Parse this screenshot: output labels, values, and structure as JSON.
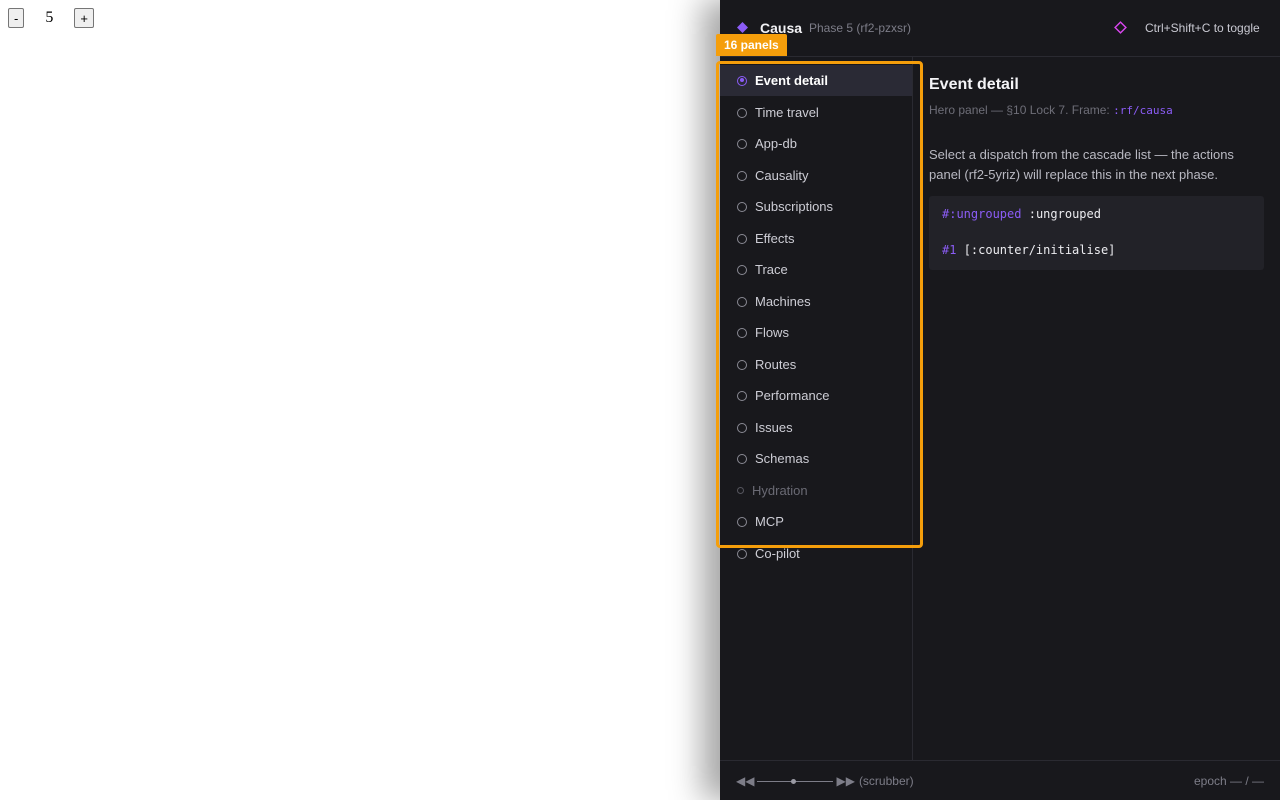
{
  "counter": {
    "decrement": "-",
    "value": "5",
    "increment": "+"
  },
  "devtools": {
    "brand": "Causa",
    "phase": "Phase 5 (rf2-pzxsr)",
    "toggle_hint": "Ctrl+Shift+C to toggle",
    "accent": "#8b5cf6",
    "overlay_badge": "16 panels",
    "overlay_color": "#f59e0b",
    "nav": [
      {
        "label": "Event detail",
        "state": "active"
      },
      {
        "label": "Time travel",
        "state": "normal"
      },
      {
        "label": "App-db",
        "state": "normal"
      },
      {
        "label": "Causality",
        "state": "normal"
      },
      {
        "label": "Subscriptions",
        "state": "normal"
      },
      {
        "label": "Effects",
        "state": "normal"
      },
      {
        "label": "Trace",
        "state": "normal"
      },
      {
        "label": "Machines",
        "state": "normal"
      },
      {
        "label": "Flows",
        "state": "normal"
      },
      {
        "label": "Routes",
        "state": "normal"
      },
      {
        "label": "Performance",
        "state": "normal"
      },
      {
        "label": "Issues",
        "state": "normal"
      },
      {
        "label": "Schemas",
        "state": "normal"
      },
      {
        "label": "Hydration",
        "state": "disabled"
      },
      {
        "label": "MCP",
        "state": "normal"
      },
      {
        "label": "Co-pilot",
        "state": "normal"
      }
    ],
    "main": {
      "title": "Event detail",
      "subtitle_prefix": "Hero panel — §10 Lock 7. Frame: ",
      "subtitle_frame": ":rf/causa",
      "description": "Select a dispatch from the cascade list — the actions panel (rf2-5yriz) will replace this in the next phase.",
      "code": {
        "line1_tag": "#:ungrouped",
        "line1_value": ":ungrouped",
        "line2_tag": "#1",
        "line2_value": "[:counter/initialise]"
      }
    },
    "footer": {
      "rewind": "◀◀",
      "forward": "▶▶",
      "scrubber_label": "(scrubber)",
      "epoch": "epoch — / —"
    }
  }
}
